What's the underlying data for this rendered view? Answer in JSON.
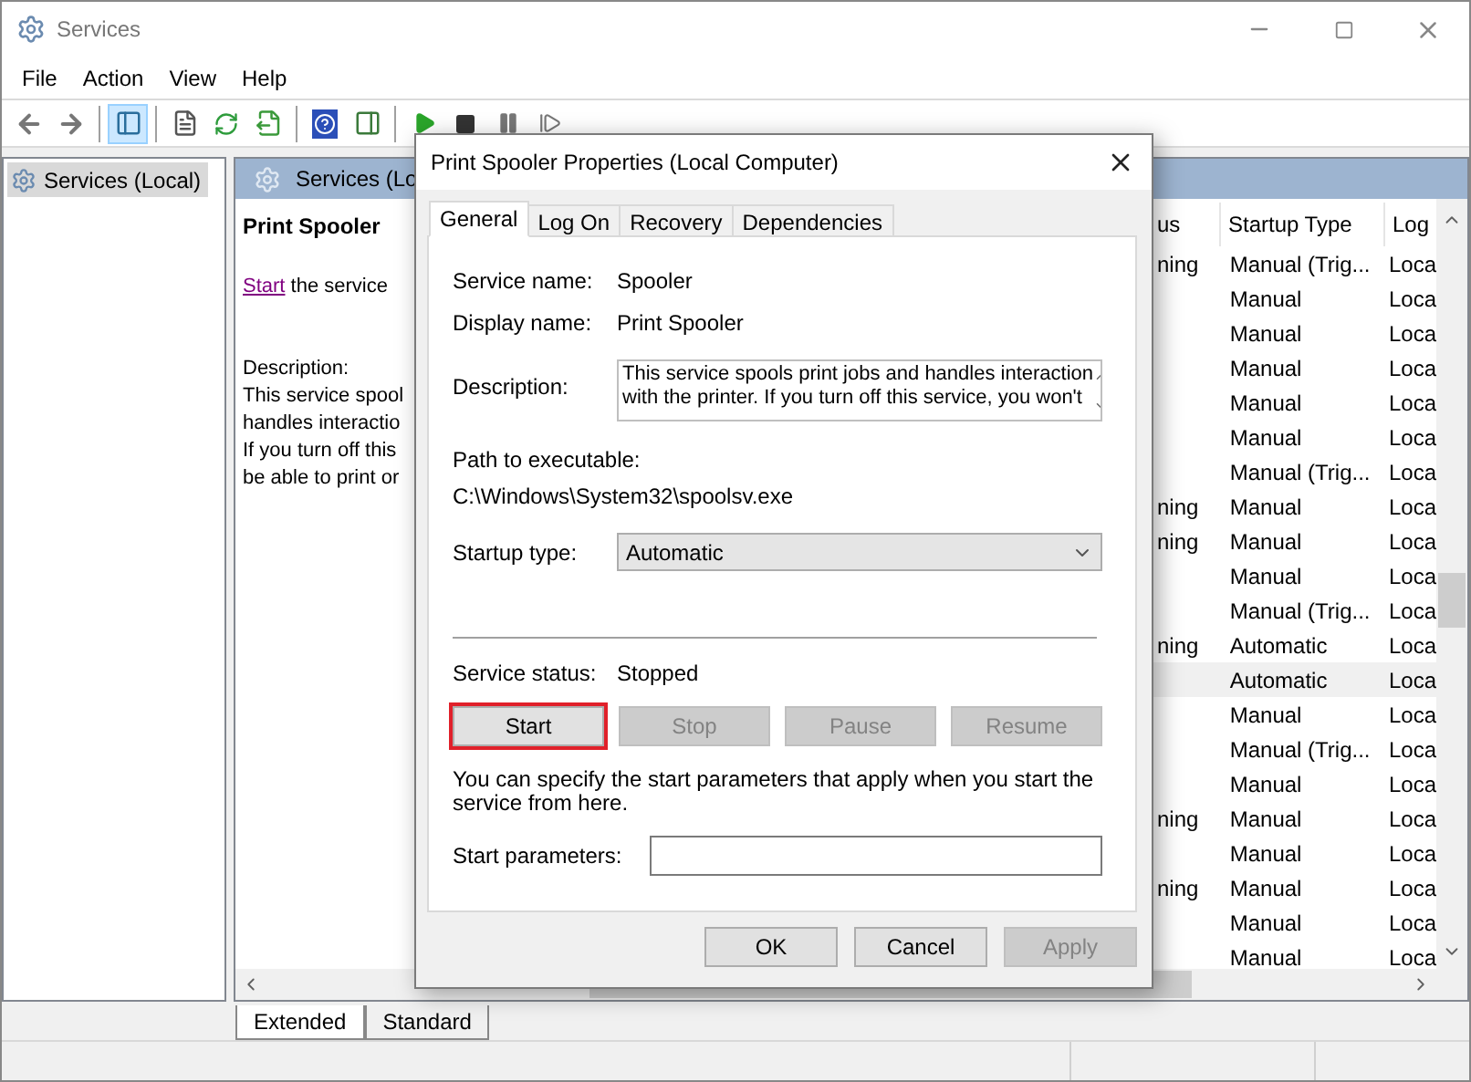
{
  "window": {
    "title": "Services"
  },
  "menu": [
    "File",
    "Action",
    "View",
    "Help"
  ],
  "toolbar": [
    {
      "kind": "back",
      "selected": false
    },
    {
      "kind": "forward",
      "selected": false
    },
    {
      "kind": "separator"
    },
    {
      "kind": "console-tree",
      "selected": true
    },
    {
      "kind": "separator"
    },
    {
      "kind": "properties",
      "selected": false
    },
    {
      "kind": "refresh",
      "selected": false
    },
    {
      "kind": "export",
      "selected": false
    },
    {
      "kind": "separator"
    },
    {
      "kind": "help",
      "selected": false
    },
    {
      "kind": "action-pane",
      "selected": false
    },
    {
      "kind": "separator"
    },
    {
      "kind": "start",
      "selected": false
    },
    {
      "kind": "stop",
      "selected": false
    },
    {
      "kind": "pause",
      "selected": false
    },
    {
      "kind": "resume",
      "selected": false
    }
  ],
  "tree": {
    "items": [
      {
        "label": "Services (Local)",
        "selected": true
      }
    ]
  },
  "panel": {
    "header": "Services (Lo",
    "extended": {
      "title": "Print Spooler",
      "link": "Start",
      "link_suffix": " the service",
      "description_label": "Description:",
      "description_lines": [
        "This service spool",
        "handles interactio",
        "If you turn off this",
        "be able to print or"
      ]
    },
    "table": {
      "columns": [
        "us",
        "Startup Type",
        "Log"
      ],
      "rows": [
        {
          "cells": [
            "ning",
            "Manual (Trig...",
            "Loca"
          ],
          "selected": false
        },
        {
          "cells": [
            "",
            "Manual",
            "Loca"
          ],
          "selected": false
        },
        {
          "cells": [
            "",
            "Manual",
            "Loca"
          ],
          "selected": false
        },
        {
          "cells": [
            "",
            "Manual",
            "Loca"
          ],
          "selected": false
        },
        {
          "cells": [
            "",
            "Manual",
            "Loca"
          ],
          "selected": false
        },
        {
          "cells": [
            "",
            "Manual",
            "Loca"
          ],
          "selected": false
        },
        {
          "cells": [
            "",
            "Manual (Trig...",
            "Loca"
          ],
          "selected": false
        },
        {
          "cells": [
            "ning",
            "Manual",
            "Loca"
          ],
          "selected": false
        },
        {
          "cells": [
            "ning",
            "Manual",
            "Loca"
          ],
          "selected": false
        },
        {
          "cells": [
            "",
            "Manual",
            "Loca"
          ],
          "selected": false
        },
        {
          "cells": [
            "",
            "Manual (Trig...",
            "Loca"
          ],
          "selected": false
        },
        {
          "cells": [
            "ning",
            "Automatic",
            "Loca"
          ],
          "selected": false
        },
        {
          "cells": [
            "",
            "Automatic",
            "Loca"
          ],
          "selected": true
        },
        {
          "cells": [
            "",
            "Manual",
            "Loca"
          ],
          "selected": false
        },
        {
          "cells": [
            "",
            "Manual (Trig...",
            "Loca"
          ],
          "selected": false
        },
        {
          "cells": [
            "",
            "Manual",
            "Loca"
          ],
          "selected": false
        },
        {
          "cells": [
            "ning",
            "Manual",
            "Loca"
          ],
          "selected": false
        },
        {
          "cells": [
            "",
            "Manual",
            "Loca"
          ],
          "selected": false
        },
        {
          "cells": [
            "ning",
            "Manual",
            "Loca"
          ],
          "selected": false
        },
        {
          "cells": [
            "",
            "Manual",
            "Loca"
          ],
          "selected": false
        },
        {
          "cells": [
            "",
            "Manual",
            "Loca"
          ],
          "selected": false
        }
      ]
    }
  },
  "view_tabs": [
    {
      "label": "Extended",
      "selected": true
    },
    {
      "label": "Standard",
      "selected": false
    }
  ],
  "dialog": {
    "title": "Print Spooler Properties (Local Computer)",
    "tabs": [
      {
        "label": "General",
        "selected": true
      },
      {
        "label": "Log On",
        "selected": false
      },
      {
        "label": "Recovery",
        "selected": false
      },
      {
        "label": "Dependencies",
        "selected": false
      }
    ],
    "fields": [
      {
        "label": "Service name:",
        "value": "Spooler"
      },
      {
        "label": "Display name:",
        "value": "Print Spooler"
      }
    ],
    "description": {
      "label": "Description:",
      "lines": [
        "This service spools print jobs and handles interaction",
        "with the printer.  If you turn off this service, you won't"
      ]
    },
    "path_label": "Path to executable:",
    "path": "C:\\Windows\\System32\\spoolsv.exe",
    "startup": {
      "label": "Startup type:",
      "value": "Automatic"
    },
    "status": {
      "label": "Service status:",
      "value": "Stopped"
    },
    "buttons": [
      {
        "label": "Start",
        "disabled": false,
        "highlighted": true
      },
      {
        "label": "Stop",
        "disabled": true,
        "highlighted": false
      },
      {
        "label": "Pause",
        "disabled": true,
        "highlighted": false
      },
      {
        "label": "Resume",
        "disabled": true,
        "highlighted": false
      }
    ],
    "hint": "You can specify the start parameters that apply when you start the service from here.",
    "params_label": "Start parameters:",
    "footer_buttons": [
      {
        "label": "OK",
        "disabled": false
      },
      {
        "label": "Cancel",
        "disabled": false
      },
      {
        "label": "Apply",
        "disabled": true
      }
    ]
  }
}
